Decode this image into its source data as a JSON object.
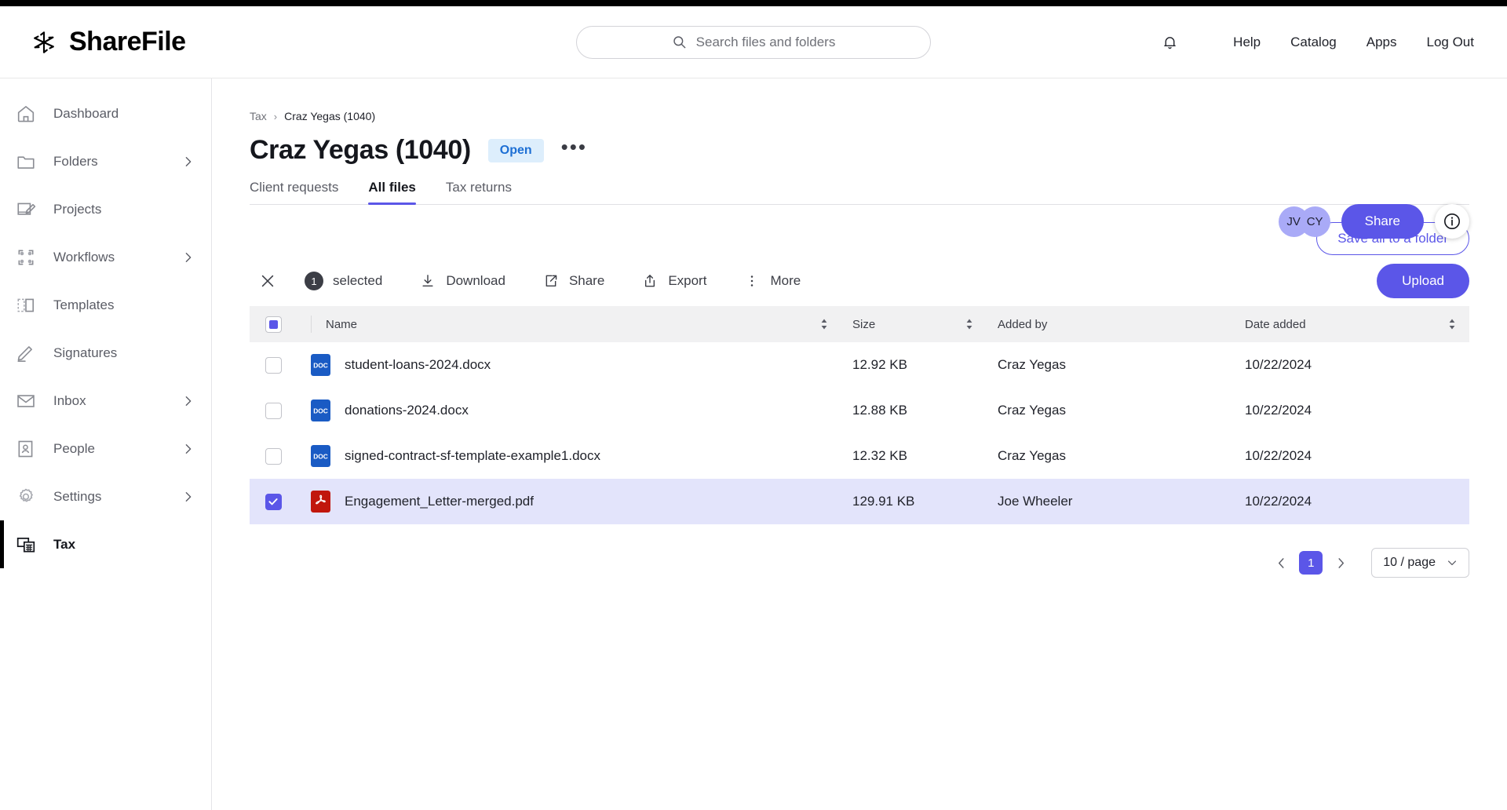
{
  "app": {
    "brand_name": "ShareFile",
    "logo_icon": "sharefile-pinwheel-icon"
  },
  "search": {
    "placeholder": "Search files and folders",
    "icon": "search-icon",
    "value": ""
  },
  "header": {
    "bell_icon": "notification-bell-icon",
    "links": [
      {
        "label": "Help"
      },
      {
        "label": "Catalog"
      },
      {
        "label": "Apps"
      },
      {
        "label": "Log Out"
      }
    ]
  },
  "sidebar": {
    "items": [
      {
        "label": "Dashboard",
        "icon": "home-icon",
        "chevron": false,
        "active": false
      },
      {
        "label": "Folders",
        "icon": "folder-icon",
        "chevron": true,
        "active": false
      },
      {
        "label": "Projects",
        "icon": "projects-icon",
        "chevron": false,
        "active": false
      },
      {
        "label": "Workflows",
        "icon": "workflows-icon",
        "chevron": true,
        "active": false
      },
      {
        "label": "Templates",
        "icon": "templates-icon",
        "chevron": false,
        "active": false
      },
      {
        "label": "Signatures",
        "icon": "signature-pen-icon",
        "chevron": false,
        "active": false
      },
      {
        "label": "Inbox",
        "icon": "envelope-icon",
        "chevron": true,
        "active": false
      },
      {
        "label": "People",
        "icon": "people-icon",
        "chevron": true,
        "active": false
      },
      {
        "label": "Settings",
        "icon": "gear-icon",
        "chevron": true,
        "active": false
      },
      {
        "label": "Tax",
        "icon": "tax-calculator-icon",
        "chevron": false,
        "active": true
      }
    ]
  },
  "breadcrumb": {
    "root": "Tax",
    "separator": "›",
    "current": "Craz Yegas (1040)"
  },
  "page": {
    "title": "Craz Yegas (1040)",
    "status_badge": "Open",
    "overflow_menu": "•••"
  },
  "title_actions": {
    "avatars": [
      {
        "initials": "JV"
      },
      {
        "initials": "CY"
      }
    ],
    "share_label": "Share",
    "info_icon": "info-circle-icon"
  },
  "tabs": [
    {
      "label": "Client requests",
      "active": false
    },
    {
      "label": "All files",
      "active": true
    },
    {
      "label": "Tax returns",
      "active": false
    }
  ],
  "actions": {
    "save_all_label": "Save all to a folder",
    "upload_label": "Upload"
  },
  "selection_bar": {
    "close_icon": "close-x-icon",
    "count": "1",
    "selected_label": "selected",
    "actions": [
      {
        "label": "Download",
        "icon": "download-icon"
      },
      {
        "label": "Share",
        "icon": "share-external-icon"
      },
      {
        "label": "Export",
        "icon": "export-upload-icon"
      },
      {
        "label": "More",
        "icon": "kebab-vertical-icon"
      }
    ]
  },
  "table": {
    "select_all_state": "indeterminate",
    "columns": [
      {
        "label": "Name",
        "sortable": true
      },
      {
        "label": "Size",
        "sortable": true
      },
      {
        "label": "Added by",
        "sortable": false
      },
      {
        "label": "Date added",
        "sortable": true
      }
    ],
    "rows": [
      {
        "name": "student-loans-2024.docx",
        "type": "DOC",
        "size": "12.92 KB",
        "added_by": "Craz Yegas",
        "date_added": "10/22/2024",
        "selected": false
      },
      {
        "name": "donations-2024.docx",
        "type": "DOC",
        "size": "12.88 KB",
        "added_by": "Craz Yegas",
        "date_added": "10/22/2024",
        "selected": false
      },
      {
        "name": "signed-contract-sf-template-example1.docx",
        "type": "DOC",
        "size": "12.32 KB",
        "added_by": "Craz Yegas",
        "date_added": "10/22/2024",
        "selected": false
      },
      {
        "name": "Engagement_Letter-merged.pdf",
        "type": "PDF",
        "size": "129.91 KB",
        "added_by": "Joe Wheeler",
        "date_added": "10/22/2024",
        "selected": true
      }
    ]
  },
  "pagination": {
    "prev_icon": "chevron-left-icon",
    "next_icon": "chevron-right-icon",
    "current_page": "1",
    "per_page_label": "10 / page",
    "per_page_chevron": "chevron-down-icon"
  },
  "colors": {
    "accent_purple": "#5b56e8",
    "avatar_purple": "#a9aaf7",
    "selected_row": "#e3e4fb",
    "badge_blue_bg": "#ddeefc",
    "badge_blue_text": "#1d6fd4",
    "doc_blue": "#1a5bc4",
    "pdf_red": "#c1160c"
  }
}
